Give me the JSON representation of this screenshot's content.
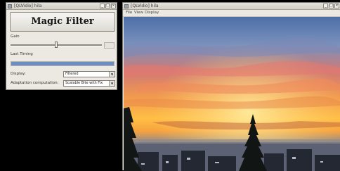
{
  "left_window": {
    "title": "[QLVidio] hila",
    "magic_button_label": "Magic Filter",
    "gain_label": "Gain",
    "gain_value": 0.5,
    "last_timing_label": "Last Timing",
    "timing_progress": 1.0,
    "display_label": "Display:",
    "display_value": "Filtered",
    "adaptation_label": "Adaptation computation:",
    "adaptation_value": "Scalable Bite with Fix"
  },
  "right_window": {
    "title": "[QLVidio] hila",
    "menu": [
      "File",
      "View",
      "Display"
    ]
  },
  "window_buttons": [
    "_",
    "□",
    "×"
  ],
  "colors": {
    "progress": "#6b8fc4",
    "titlebar": "#d8d5cd"
  }
}
